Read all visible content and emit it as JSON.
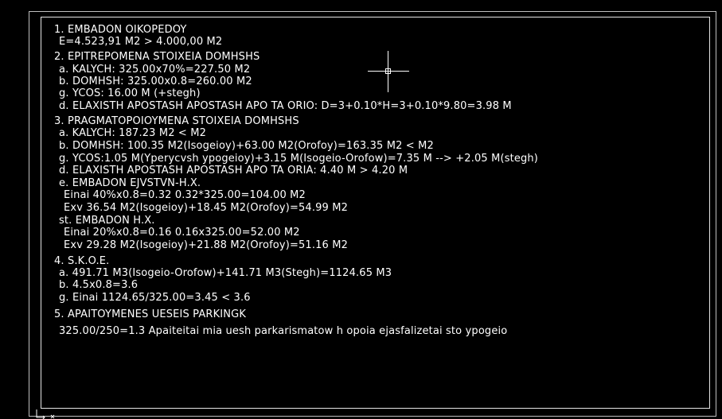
{
  "colors": {
    "background": "#000000",
    "text": "#ffffff",
    "frame": "#e6e6e6"
  },
  "drawing_text": {
    "lines": [
      "1. EMBADON OIKOPEDOY",
      "E=4.523,91 M2 > 4.000,00 M2",
      "2. EPITREPOMENA STOIXEIA DOMHSHS",
      "a. KALYCH: 325.00x70%=227.50 M2",
      "b. DOMHSH: 325.00x0.8=260.00 M2",
      "g. YCOS: 16.00 M (+stegh)",
      "d. ELAXISTH APOSTASH APOSTASH APO TA ORIO: D=3+0.10*H=3+0.10*9.80=3.98 M",
      "3. PRAGMATOPOIOYMENA STOIXEIA DOMHSHS",
      "a. KALYCH: 187.23 M2 < M2",
      "b. DOMHSH: 100.35 M2(Isogeioy)+63.00 M2(Orofoy)=163.35 M2 < M2",
      "g. YCOS:1.05 M(Yperycvsh ypogeioy)+3.15 M(Isogeio-Orofow)=7.35 M --> +2.05 M(stegh)",
      "d. ELAXISTH APOSTASH APOSTASH APO TA ORIA: 4.40 M > 4.20 M",
      "e. EMBADON EJVSTVN-H.X.",
      "Einai 40%x0.8=0.32 0.32*325.00=104.00 M2",
      "Exv 36.54 M2(Isogeioy)+18.45 M2(Orofoy)=54.99 M2",
      "st. EMBADON H.X.",
      "Einai 20%x0.8=0.16 0.16x325.00=52.00 M2",
      "Exv 29.28 M2(Isogeioy)+21.88 M2(Orofoy)=51.16 M2",
      "4. S.K.O.E.",
      "a. 491.71 M3(Isogeio-Orofow)+141.71 M3(Stegh)=1124.65 M3",
      "b. 4.5x0.8=3.6",
      "g. Einai 1124.65/325.00=3.45 < 3.6",
      "5. APAITOYMENES UESEIS PARKINGK",
      "325.00/250=1.3 Apaiteitai mia uesh parkarismatow h opoia ejasfalizetai sto ypogeio"
    ]
  }
}
